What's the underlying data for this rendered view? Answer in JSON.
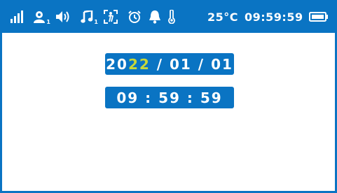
{
  "statusbar": {
    "icons": [
      {
        "name": "signal-icon"
      },
      {
        "name": "user-icon",
        "badge": "1"
      },
      {
        "name": "speaker-icon"
      },
      {
        "name": "music-icon",
        "badge": "1"
      },
      {
        "name": "person-tracking-icon"
      },
      {
        "name": "alarm-clock-icon"
      },
      {
        "name": "bell-icon"
      },
      {
        "name": "thermometer-icon"
      },
      {
        "name": "battery-icon"
      }
    ],
    "temperature": "25°C",
    "time": "09:59:59"
  },
  "date": {
    "year_prefix": "20",
    "year_suffix": "22",
    "rest": " / 01 / 01"
  },
  "clock": {
    "time": "09 : 59 : 59"
  },
  "colors": {
    "accent": "#0a74c3",
    "highlight": "#c7d73a",
    "background": "#ffffff"
  }
}
